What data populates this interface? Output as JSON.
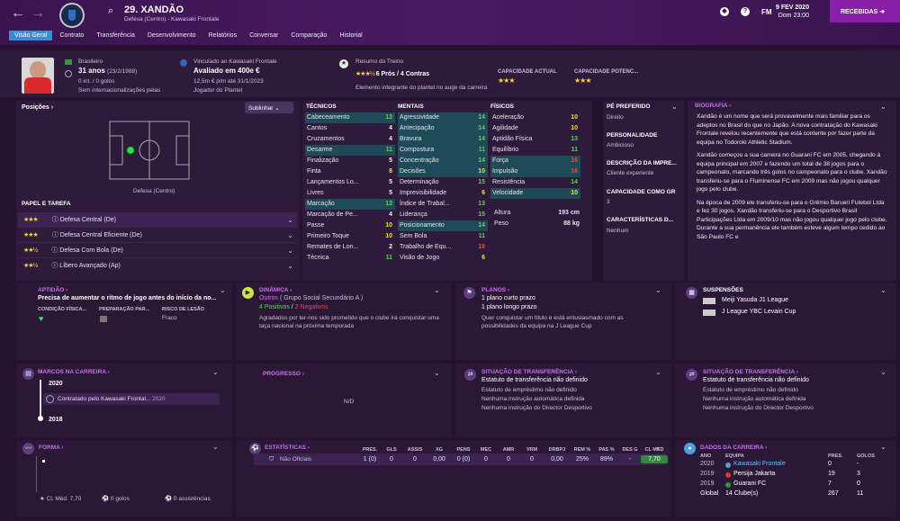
{
  "header": {
    "back": "←",
    "forward": "→",
    "player_title": "29. XANDÃO",
    "subtitle": "Defesa (Centro) - Kawasaki Frontale",
    "fm": "FM",
    "date": "9 FEV 2020",
    "time": "Dom 23:00",
    "inbox": "RECEBIDAS"
  },
  "tabs": [
    "Visão Geral",
    "Contrato",
    "Transferência",
    "Desenvolvimento",
    "Relatórios",
    "Conversar",
    "Comparação",
    "Historial"
  ],
  "profile": {
    "nation": "Brasileiro",
    "age": "31 anos",
    "dob": "(23/2/1988)",
    "intl": "0 int. / 0 golos",
    "intl2": "Sem internacionalizações pelas",
    "club_line": "Vinculado ao Kawasaki Frontale",
    "value": "Avaliado em 400e €",
    "wage": "12,5m € p/m até 31/1/2023",
    "squad": "Jogador do Plantel",
    "training": "Resumo do Treino",
    "training_sum": "6 Prós / 4 Contras",
    "training_note": "Elemento integrante do plantel no auge da carreira",
    "cap_atual": "CAPACIDADE ACTUAL",
    "cap_pot": "CAPACIDADE POTENC..."
  },
  "positions": {
    "title": "Posições",
    "filter": "Sublinhar",
    "pos_label": "Defesa (Centro)",
    "roles_title": "PAPEL E TAREFA",
    "roles": [
      {
        "stars": "★★★",
        "name": "Defesa Central (De)"
      },
      {
        "stars": "★★★",
        "name": "Defesa Central Eficiente (De)"
      },
      {
        "stars": "★★½",
        "name": "Defesa Com Bola (De)"
      },
      {
        "stars": "★★½",
        "name": "Líbero Avançado (Ap)"
      }
    ]
  },
  "tecnicos": {
    "title": "TÉCNICOS",
    "items": [
      [
        "Cabeceamento",
        "13"
      ],
      [
        "Cantos",
        "4"
      ],
      [
        "Cruzamentos",
        "4"
      ],
      [
        "Desarme",
        "11"
      ],
      [
        "Finalização",
        "5"
      ],
      [
        "Finta",
        "8"
      ],
      [
        "Lançamentos Lo...",
        "5"
      ],
      [
        "Livres",
        "5"
      ],
      [
        "Marcação",
        "13"
      ],
      [
        "Marcação de Pe...",
        "4"
      ],
      [
        "Passe",
        "10"
      ],
      [
        "Primeiro Toque",
        "10"
      ],
      [
        "Remates de Lon...",
        "2"
      ],
      [
        "Técnica",
        "11"
      ]
    ]
  },
  "mentais": {
    "title": "MENTAIS",
    "items": [
      [
        "Agressividade",
        "14"
      ],
      [
        "Antecipação",
        "14"
      ],
      [
        "Bravura",
        "14"
      ],
      [
        "Compostura",
        "11"
      ],
      [
        "Concentração",
        "14"
      ],
      [
        "Decisões",
        "10"
      ],
      [
        "Determinação",
        "15"
      ],
      [
        "Imprevisibilidade",
        "6"
      ],
      [
        "Índice de Trabal...",
        "13"
      ],
      [
        "Liderança",
        "15"
      ],
      [
        "Posicionamento",
        "14"
      ],
      [
        "Sem Bola",
        "11"
      ],
      [
        "Trabalho de Equ...",
        "18"
      ],
      [
        "Visão de Jogo",
        "6"
      ]
    ]
  },
  "fisicos": {
    "title": "FÍSICOS",
    "items": [
      [
        "Aceleração",
        "10"
      ],
      [
        "Agilidade",
        "10"
      ],
      [
        "Aptidão Física",
        "13"
      ],
      [
        "Equilíbrio",
        "11"
      ],
      [
        "Força",
        "16"
      ],
      [
        "Impulsão",
        "16"
      ],
      [
        "Resistência",
        "14"
      ],
      [
        "Velocidade",
        "10"
      ]
    ],
    "altura_l": "Altura",
    "altura": "193 cm",
    "peso_l": "Peso",
    "peso": "88 kg"
  },
  "side": {
    "pe_l": "PÉ PREFERIDO",
    "pe": "Direito",
    "pers_l": "PERSONALIDADE",
    "pers": "Ambicioso",
    "desc_l": "DESCRIÇÃO DA IMPRE...",
    "desc": "Cliente experiente",
    "cap_l": "CAPACIDADE COMO GR",
    "cap": "3",
    "car_l": "CARACTERÍSTICAS D...",
    "car": "Nenhum"
  },
  "bio": {
    "title": "BIOGRAFIA",
    "p1": "Xandão é um nome que será provavelmente mais familiar para os adeptos no Brasil do que no Japão. A nova contratação do Kawasaki Frontale revelou recentemente que está contente por fazer parte da equipa no Todoroki Athletic Stadium.",
    "p2": "Xandão começou a sua carreira no Guarani FC em 2005, chegando à equipa principal em 2007 e fazendo um total de 38 jogos para o campeonato, marcando três golos no campeonato para o clube. Xandão transferiu-se para o Fluminense FC em 2009 mas não jogou qualquer jogo pelo clube.",
    "p3": "Na época de 2009 ele transferiu-se para o Grêmio Barueri Futebol Ltda e fez 30 jogos. Xandão transferiu-se para o Desportivo Brasil Participações Ltda em 2009/10 mas não jogou qualquer jogo pelo clube. Durante a sua permanência ele também esteve algum tempo cedido ao São Paulo FC e"
  },
  "aptidao": {
    "title": "APTIDÃO",
    "text": "Precisa de aumentar o ritmo de jogo antes do início da no...",
    "c1": "CONDIÇÃO FÍSICA...",
    "c2": "PREPARAÇÃO PAR...",
    "c3": "RISCO DE LESÃO",
    "risk": "Fraco"
  },
  "dinamica": {
    "title": "DINÂMICA",
    "group": "Outros",
    "group2": "( Grupo Social Secundário A )",
    "pos": "4 Positivos",
    "neg": "2 Negativos",
    "text": "Agradados por ter-nos sido prometido que o clube irá conquistar uma taça nacional na próxima temporada"
  },
  "planos": {
    "title": "PLANOS",
    "a": "1 plano curto prazo",
    "b": "1 plano longo prazo",
    "text": "Quer conquistar um título e está entusiasmado com as possibilidades da equipa na J League Cup"
  },
  "suspensoes": {
    "title": "SUSPENSÕES",
    "a": "Meiji Yasuda J1 League",
    "b": "J League YBC Levain Cup"
  },
  "marcos": {
    "title": "MARCOS NA CARREIRA",
    "y1": "2020",
    "item": "Contratado pelo Kawasaki Frontal...",
    "item_y": "2020",
    "y2": "2018"
  },
  "progresso": {
    "title": "PROGRESSO",
    "na": "N/D"
  },
  "transf1": {
    "title": "SITUAÇÃO DE TRANSFERÊNCIA",
    "status": "Estatuto de transferência não definido",
    "l1": "Estatuto de empréstimo não definido",
    "l2": "Nenhuma instrução automática definida",
    "l3": "Nenhuma instrução do Director Desportivo"
  },
  "transf2": {
    "title": "SITUAÇÃO DE TRANSFERÊNCIA",
    "status": "Estatuto de transferência não definido",
    "l1": "Estatuto de empréstimo não definido",
    "l2": "Nenhuma instrução automática definida",
    "l3": "Nenhuma instrução do Director Desportivo"
  },
  "forma": {
    "title": "FORMA",
    "rating": "Cl. Méd. 7,70",
    "goals": "0 golos",
    "assists": "0 assistências"
  },
  "estat": {
    "title": "ESTATÍSTICAS",
    "headers": [
      "PRES.",
      "GLS",
      "ASSIS",
      "XG",
      "PENS",
      "MEC",
      "AMR",
      "VRM",
      "DRBPJ",
      "REM %",
      "PAS %",
      "DES G",
      "CL MED"
    ],
    "row_label": "Não Oficiais",
    "values": [
      "1 (0)",
      "0",
      "0",
      "0,00",
      "0 (0)",
      "0",
      "0",
      "0",
      "0,00",
      "25%",
      "89%",
      "-",
      "7,70"
    ]
  },
  "carreira": {
    "title": "DADOS DA CARREIRA",
    "h_ano": "ANO",
    "h_eq": "EQUIPA",
    "h_pres": "PRES.",
    "h_gol": "GOLOS",
    "rows": [
      [
        "2020",
        "Kawasaki Frontale",
        "0",
        "-"
      ],
      [
        "2019",
        "Persija Jakarta",
        "19",
        "3"
      ],
      [
        "2019",
        "Guarani FC",
        "7",
        "0"
      ]
    ],
    "total": [
      "Global",
      "14 Clube(s)",
      "267",
      "11"
    ]
  }
}
